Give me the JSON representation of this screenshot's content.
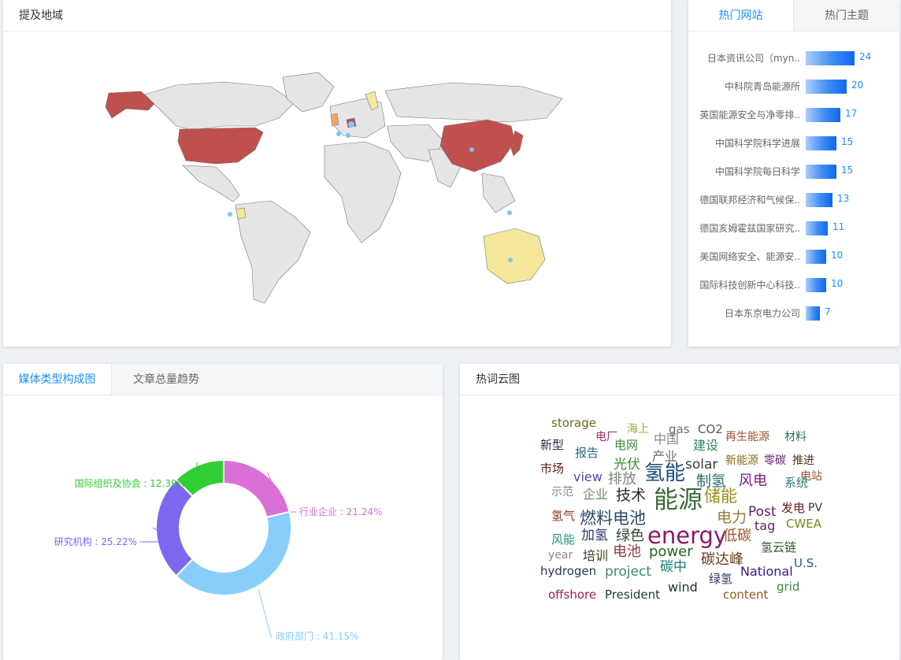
{
  "map_panel": {
    "title": "提及地域",
    "legend_colors": {
      "high": "#c0504d",
      "mid": "#f4e79a",
      "low": "#f3a46a",
      "none": "#e5e5e5",
      "marker": "#7fc4f4"
    }
  },
  "sites_panel": {
    "tabs": [
      {
        "label": "热门网站",
        "active": true
      },
      {
        "label": "热门主题",
        "active": false
      }
    ],
    "max_value": 24,
    "items": [
      {
        "label": "日本资讯公司（myn..",
        "value": 24
      },
      {
        "label": "中科院青岛能源所",
        "value": 20
      },
      {
        "label": "英国能源安全与净零排..",
        "value": 17
      },
      {
        "label": "中国科学院科学进展",
        "value": 15
      },
      {
        "label": "中国科学院每日科学",
        "value": 15
      },
      {
        "label": "德国联邦经济和气候保..",
        "value": 13
      },
      {
        "label": "德国亥姆霍兹国家研究..",
        "value": 11
      },
      {
        "label": "美国网络安全、能源安..",
        "value": 10
      },
      {
        "label": "国际科技创新中心科技..",
        "value": 10
      },
      {
        "label": "日本东京电力公司",
        "value": 7
      }
    ]
  },
  "media_panel": {
    "tabs": [
      {
        "label": "媒体类型构成图",
        "active": true
      },
      {
        "label": "文章总量趋势",
        "active": false
      }
    ]
  },
  "chart_data": {
    "type": "pie",
    "donut": true,
    "series": [
      {
        "name": "政府部门",
        "value": 41.15,
        "label": "政府部门 : 41.15%",
        "color": "#87cefa"
      },
      {
        "name": "研究机构",
        "value": 25.22,
        "label": "研究机构 : 25.22%",
        "color": "#7b68ee"
      },
      {
        "name": "国际组织及协会",
        "value": 12.39,
        "label": "国际组织及协会 : 12.39%",
        "color": "#32cd32"
      },
      {
        "name": "行业企业",
        "value": 21.24,
        "label": "行业企业 : 21.24%",
        "color": "#da70d6"
      }
    ],
    "legend_position": "bottom"
  },
  "cloud_panel": {
    "title": "热词云图",
    "words": [
      {
        "text": "storage",
        "color": "#6b6b1f"
      },
      {
        "text": "海上",
        "color": "#9aab3a"
      },
      {
        "text": "gas",
        "color": "#7a6a6a"
      },
      {
        "text": "CO2",
        "color": "#555555"
      },
      {
        "text": "电厂",
        "color": "#a0306a"
      },
      {
        "text": "中国",
        "color": "#8a8a8a"
      },
      {
        "text": "再生能源",
        "color": "#a0522d"
      },
      {
        "text": "材料",
        "color": "#2e6b6b"
      },
      {
        "text": "新型",
        "color": "#2a2a4a"
      },
      {
        "text": "报告",
        "color": "#2d6a8a"
      },
      {
        "text": "电网",
        "color": "#3a8a3a"
      },
      {
        "text": "建设",
        "color": "#2e8b57"
      },
      {
        "text": "产业",
        "color": "#6b6b6b"
      },
      {
        "text": "新能源",
        "color": "#8b6914"
      },
      {
        "text": "零碳",
        "color": "#6a1a6a"
      },
      {
        "text": "推进",
        "color": "#4a3a1a"
      },
      {
        "text": "市场",
        "color": "#5a1a1a"
      },
      {
        "text": "光伏",
        "color": "#3a8a3a"
      },
      {
        "text": "solar",
        "color": "#3a3a3a"
      },
      {
        "text": "电站",
        "color": "#a0522d"
      },
      {
        "text": "view",
        "color": "#4a4aa0"
      },
      {
        "text": "排放",
        "color": "#7a8a7a"
      },
      {
        "text": "氢能",
        "color": "#1a4a7a"
      },
      {
        "text": "制氢",
        "color": "#2e6b6b"
      },
      {
        "text": "风电",
        "color": "#7a1a7a"
      },
      {
        "text": "系统",
        "color": "#2a7a7a"
      },
      {
        "text": "示范",
        "color": "#8a8a8a"
      },
      {
        "text": "企业",
        "color": "#6b8b6b"
      },
      {
        "text": "技术",
        "color": "#2a2a2a"
      },
      {
        "text": "能源",
        "color": "#3a6a3a"
      },
      {
        "text": "储能",
        "color": "#a08a1a"
      },
      {
        "text": "发电",
        "color": "#6a1a1a"
      },
      {
        "text": "PV",
        "color": "#3a3a3a"
      },
      {
        "text": "氢气",
        "color": "#8a3a1a"
      },
      {
        "text": "燃料电池",
        "color": "#2a4a6a"
      },
      {
        "text": "电力",
        "color": "#9a7a3a"
      },
      {
        "text": "Post",
        "color": "#6a1a6a"
      },
      {
        "text": "tag",
        "color": "#6a1a6a"
      },
      {
        "text": "CWEA",
        "color": "#6b8b1a"
      },
      {
        "text": "风能",
        "color": "#2a8a7a"
      },
      {
        "text": "加氢",
        "color": "#2a3a6a"
      },
      {
        "text": "绿色",
        "color": "#2a4a2a"
      },
      {
        "text": "energy",
        "color": "#8a1a6a"
      },
      {
        "text": "低碳",
        "color": "#a0522d"
      },
      {
        "text": "氢云链",
        "color": "#2a5a2a"
      },
      {
        "text": "year",
        "color": "#8a8a8a"
      },
      {
        "text": "培训",
        "color": "#4a3a1a"
      },
      {
        "text": "电池",
        "color": "#8a3a3a"
      },
      {
        "text": "power",
        "color": "#1a6a1a"
      },
      {
        "text": "碳达峰",
        "color": "#6a3a1a"
      },
      {
        "text": "hydrogen",
        "color": "#2a3a5a"
      },
      {
        "text": "project",
        "color": "#3a8a7a"
      },
      {
        "text": "碳中",
        "color": "#1a7a7a"
      },
      {
        "text": "National",
        "color": "#3a1a8a"
      },
      {
        "text": "U.S.",
        "color": "#2a5a8a"
      },
      {
        "text": "绿氢",
        "color": "#2a3a6a"
      },
      {
        "text": "wind",
        "color": "#1a3a1a"
      },
      {
        "text": "grid",
        "color": "#3a8a3a"
      },
      {
        "text": "offshore",
        "color": "#a0205a"
      },
      {
        "text": "President",
        "color": "#1a3a3a"
      },
      {
        "text": "content",
        "color": "#8a5a1a"
      }
    ]
  }
}
